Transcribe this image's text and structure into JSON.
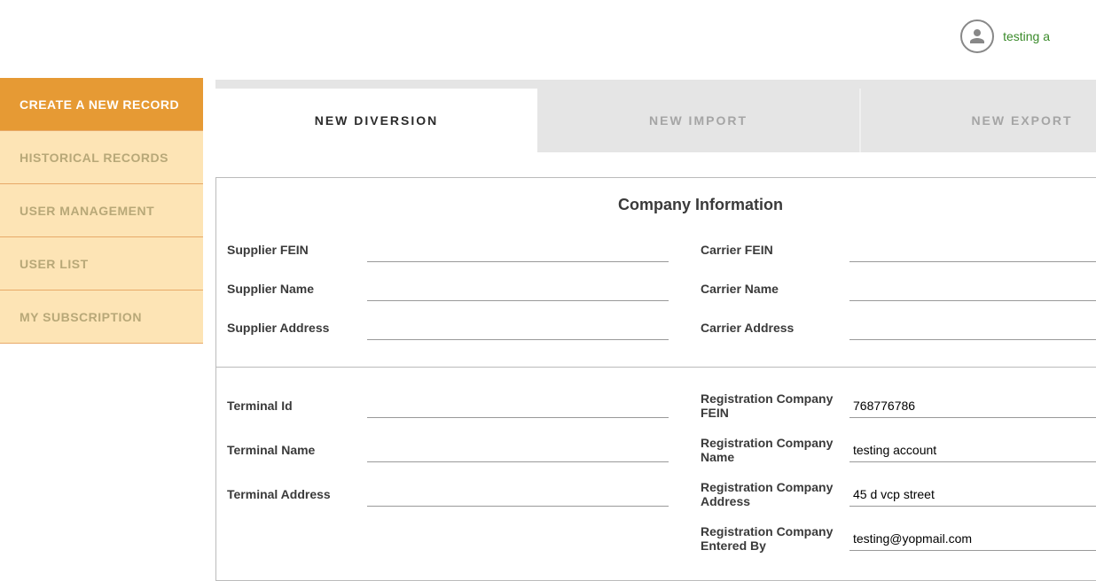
{
  "header": {
    "username": "testing a"
  },
  "sidebar": {
    "items": [
      {
        "label": "CREATE A NEW RECORD",
        "active": true
      },
      {
        "label": "HISTORICAL RECORDS",
        "active": false
      },
      {
        "label": "USER MANAGEMENT",
        "active": false
      },
      {
        "label": "USER LIST",
        "active": false
      },
      {
        "label": "MY SUBSCRIPTION",
        "active": false
      }
    ]
  },
  "tabs": [
    {
      "label": "NEW DIVERSION",
      "active": true
    },
    {
      "label": "NEW IMPORT",
      "active": false
    },
    {
      "label": "NEW EXPORT",
      "active": false
    }
  ],
  "panel": {
    "title": "Company Information",
    "section1": {
      "supplier_fein_label": "Supplier FEIN",
      "supplier_fein_value": "",
      "supplier_name_label": "Supplier Name",
      "supplier_name_value": "",
      "supplier_address_label": "Supplier Address",
      "supplier_address_value": "",
      "carrier_fein_label": "Carrier FEIN",
      "carrier_fein_value": "",
      "carrier_name_label": "Carrier Name",
      "carrier_name_value": "",
      "carrier_address_label": "Carrier Address",
      "carrier_address_value": ""
    },
    "section2": {
      "terminal_id_label": "Terminal Id",
      "terminal_id_value": "",
      "terminal_name_label": "Terminal Name",
      "terminal_name_value": "",
      "terminal_address_label": "Terminal Address",
      "terminal_address_value": "",
      "reg_company_fein_label": "Registration Company FEIN",
      "reg_company_fein_value": "768776786",
      "reg_company_name_label": "Registration Company Name",
      "reg_company_name_value": "testing account",
      "reg_company_address_label": "Registration Company Address",
      "reg_company_address_value": "45 d vcp street",
      "reg_company_entered_by_label": "Registration Company Entered By",
      "reg_company_entered_by_value": "testing@yopmail.com"
    }
  }
}
